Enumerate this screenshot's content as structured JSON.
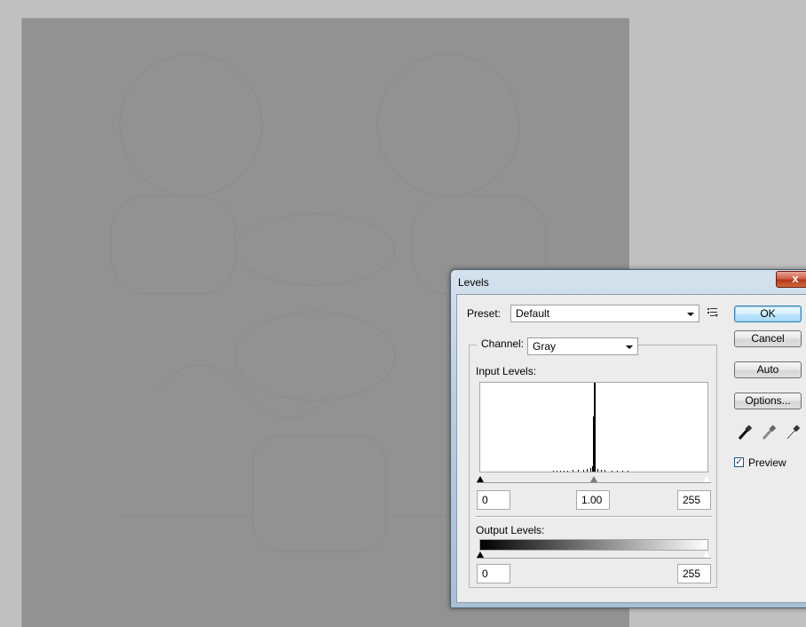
{
  "dialog": {
    "title": "Levels",
    "close_glyph": "x",
    "preset_label": "Preset:",
    "preset_value": "Default",
    "preset_menu_icon": "preset-options-icon",
    "channel_label": "Channel:",
    "channel_value": "Gray",
    "input_levels_label": "Input Levels:",
    "input_black": "0",
    "input_gamma": "1.00",
    "input_white": "255",
    "output_levels_label": "Output Levels:",
    "output_black": "0",
    "output_white": "255",
    "buttons": {
      "ok": "OK",
      "cancel": "Cancel",
      "auto": "Auto",
      "options": "Options..."
    },
    "eyedroppers": [
      "black-point-eyedropper-icon",
      "gray-point-eyedropper-icon",
      "white-point-eyedropper-icon"
    ],
    "preview_label": "Preview",
    "preview_checked": true,
    "check_glyph": "✓"
  },
  "histogram": {
    "peak_input_value": 128,
    "note_levels": [
      128
    ]
  },
  "colors": {
    "canvas": "#929292",
    "workspace": "#c0c0c0",
    "dialog_bg": "#ececec"
  }
}
